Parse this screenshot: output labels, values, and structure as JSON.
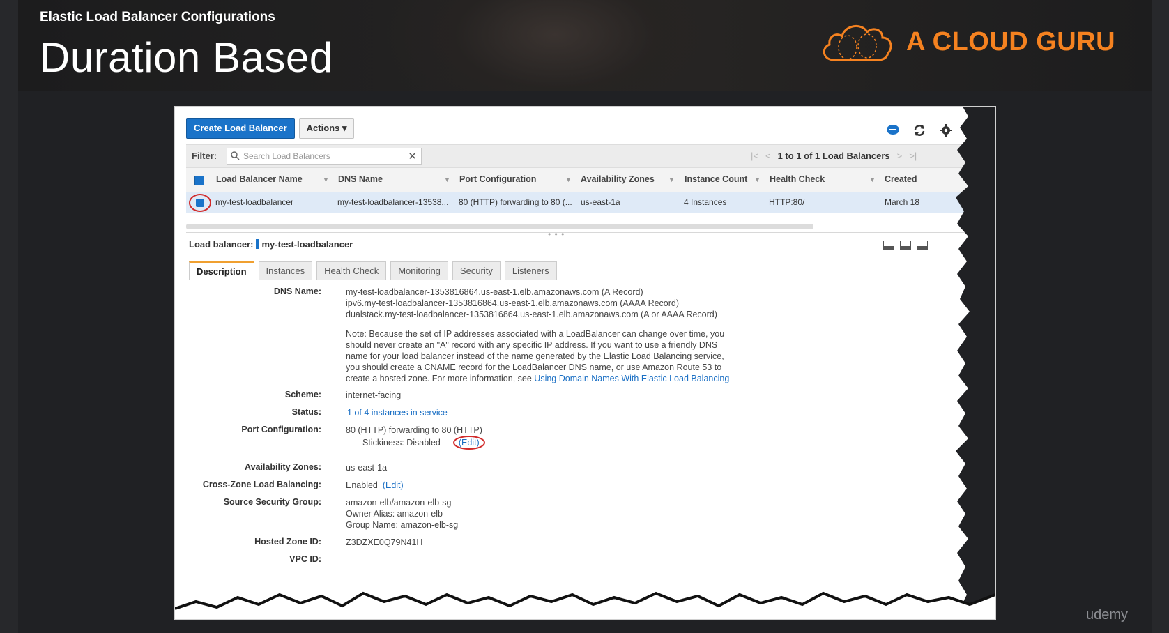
{
  "slide": {
    "subtitle": "Elastic Load Balancer Configurations",
    "title": "Duration Based",
    "brand": "A CLOUD GURU",
    "watermark": "udemy"
  },
  "toolbar": {
    "create_label": "Create Load Balancer",
    "actions_label": "Actions ▾",
    "icons": [
      "chat-icon",
      "refresh-icon",
      "gear-icon",
      "help-icon"
    ]
  },
  "filter": {
    "label": "Filter:",
    "placeholder": "Search Load Balancers",
    "pager_text": "1 to 1 of 1 Load Balancers"
  },
  "table": {
    "columns": [
      "Load Balancer Name",
      "DNS Name",
      "Port Configuration",
      "Availability Zones",
      "Instance Count",
      "Health Check",
      "Created"
    ],
    "rows": [
      {
        "name": "my-test-loadbalancer",
        "dns": "my-test-loadbalancer-13538...",
        "port": "80 (HTTP) forwarding to 80 (...",
        "zones": "us-east-1a",
        "count": "4 Instances",
        "health": "HTTP:80/",
        "created": "March 18"
      }
    ]
  },
  "detail": {
    "title_prefix": "Load balancer:",
    "title_name": "my-test-loadbalancer",
    "tabs": [
      "Description",
      "Instances",
      "Health Check",
      "Monitoring",
      "Security",
      "Listeners"
    ],
    "active_tab": "Description",
    "dns_label": "DNS Name:",
    "dns_lines": [
      "my-test-loadbalancer-1353816864.us-east-1.elb.amazonaws.com (A Record)",
      "ipv6.my-test-loadbalancer-1353816864.us-east-1.elb.amazonaws.com (AAAA Record)",
      "dualstack.my-test-loadbalancer-1353816864.us-east-1.elb.amazonaws.com (A or AAAA Record)"
    ],
    "note_lines": [
      "Note: Because the set of IP addresses associated with a LoadBalancer can change over time, you",
      "should never create an \"A\" record with any specific IP address. If you want to use a friendly DNS",
      "name for your load balancer instead of the name generated by the Elastic Load Balancing service,",
      "you should create a CNAME record for the LoadBalancer DNS name, or use Amazon Route 53 to"
    ],
    "note_last": "create a hosted zone. For more information, see",
    "note_link": "Using Domain Names With Elastic Load Balancing",
    "scheme_label": "Scheme:",
    "scheme": "internet-facing",
    "status_label": "Status:",
    "status": "1 of 4 instances in service",
    "port_label": "Port Configuration:",
    "port": "80 (HTTP) forwarding to 80 (HTTP)",
    "stickiness": "Stickiness: Disabled",
    "edit": "(Edit)",
    "zones_label": "Availability Zones:",
    "zones": "us-east-1a",
    "crosszone_label": "Cross-Zone Load Balancing:",
    "crosszone": "Enabled",
    "sg_label": "Source Security Group:",
    "sg_lines": [
      "amazon-elb/amazon-elb-sg",
      "Owner Alias: amazon-elb",
      "Group Name: amazon-elb-sg"
    ],
    "hosted_label": "Hosted Zone ID:",
    "hosted": "Z3DZXE0Q79N41H",
    "vpc_label": "VPC ID:",
    "vpc": "-"
  },
  "colors": {
    "brand": "#f58220",
    "primary": "#1a73c9",
    "highlight_ring": "#d12a2a"
  }
}
